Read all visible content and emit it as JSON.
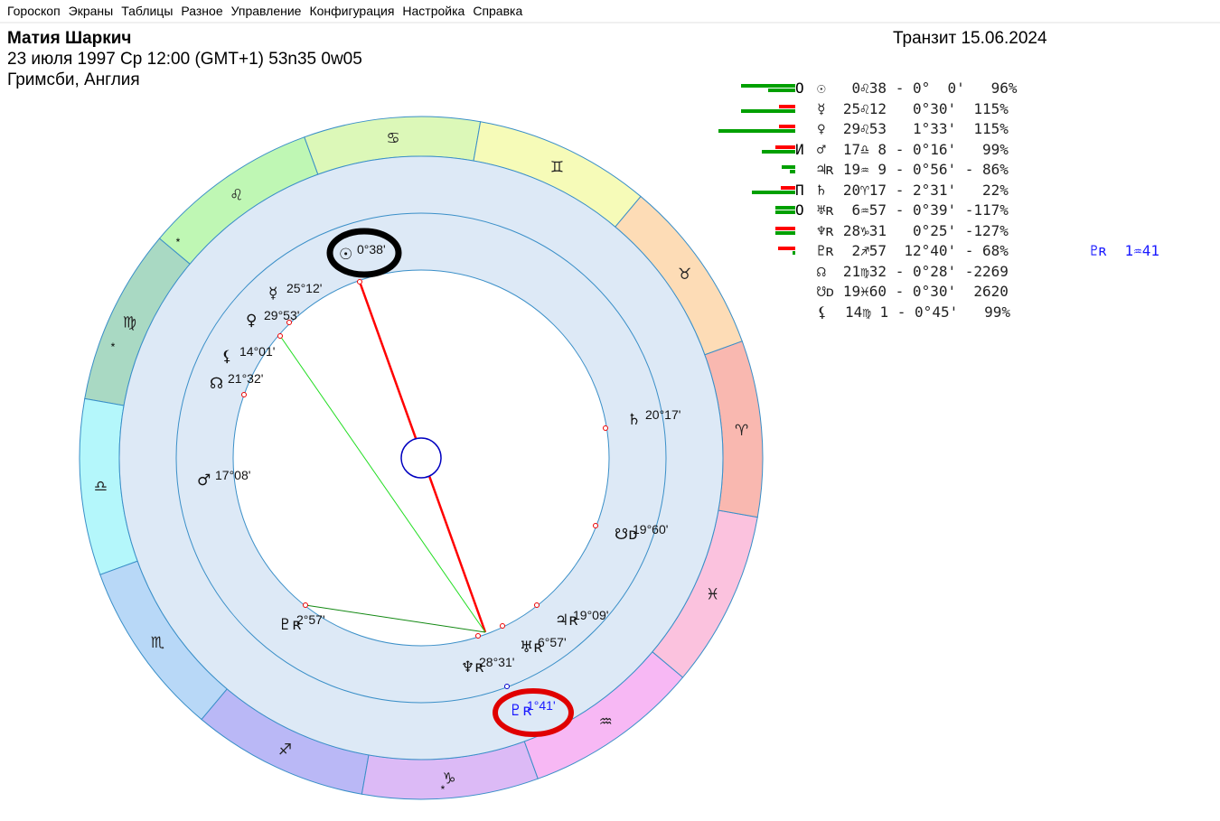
{
  "menu": [
    "Гороскоп",
    "Экраны",
    "Таблицы",
    "Разное",
    "Управление",
    "Конфигурация",
    "Настройка",
    "Справка"
  ],
  "header": {
    "name": "Матия Шаркич",
    "birth": "23 июля 1997  Ср  12:00 (GMT+1) 53n35  0w05",
    "place": "Гримсби, Англия",
    "transit": "Транзит 15.06.2024"
  },
  "colors": {
    "green_bar": "#00a000",
    "red_bar": "#ff0000",
    "ring": "#dde9f6",
    "transit_text": "#1a1aff",
    "highlight_black": "#000000",
    "highlight_red": "#e00000"
  },
  "table": [
    {
      "aspect": "O",
      "text": "☉   0♌38 - 0°  0'   96%",
      "green": [
        60,
        30
      ],
      "red": []
    },
    {
      "aspect": "",
      "text": "☿  25♌12   0°30'  115%",
      "green": [
        60
      ],
      "red": [
        18
      ]
    },
    {
      "aspect": "",
      "text": "♀  29♌53   1°33'  115%",
      "green": [
        85
      ],
      "red": [
        18
      ]
    },
    {
      "aspect": "И",
      "text": "♂  17♎ 8 - 0°16'   99%",
      "green": [
        37
      ],
      "red": [
        22
      ]
    },
    {
      "aspect": "",
      "text": "♃ʀ 19♒ 9 - 0°56' - 86%",
      "green": [
        15,
        6
      ],
      "red": []
    },
    {
      "aspect": "П",
      "text": "♄  20♈17 - 2°31'   22%",
      "green": [
        48
      ],
      "red": [
        16
      ]
    },
    {
      "aspect": "O",
      "text": "♅ʀ  6♒57 - 0°39' -117%",
      "green": [
        22,
        22
      ],
      "red": []
    },
    {
      "aspect": "",
      "text": "♆ʀ 28♑31   0°25' -127%",
      "green": [
        22
      ],
      "red": [
        22
      ]
    },
    {
      "aspect": "",
      "text": "♇ʀ  2♐57  12°40' - 68%",
      "green": [
        3
      ],
      "red": [
        19
      ],
      "transit": "♇ʀ  1♒41"
    },
    {
      "aspect": "",
      "text": "☊  21♍32 - 0°28' -2269",
      "green": [],
      "red": []
    },
    {
      "aspect": "",
      "text": "☋ᴅ 19♓60 - 0°30'  2620",
      "green": [],
      "red": []
    },
    {
      "aspect": "",
      "text": "⚸  14♍ 1 - 0°45'   99%",
      "green": [],
      "red": []
    }
  ],
  "zodiac": [
    {
      "sign": "♋",
      "color": "#dcf8b8"
    },
    {
      "sign": "♌",
      "color": "#bff7b4"
    },
    {
      "sign": "♍",
      "color": "#a9d9c3"
    },
    {
      "sign": "♎",
      "color": "#b4f7fb"
    },
    {
      "sign": "♏",
      "color": "#b8d8f7"
    },
    {
      "sign": "♐",
      "color": "#bab8f6"
    },
    {
      "sign": "♑",
      "color": "#dcbaf6"
    },
    {
      "sign": "♒",
      "color": "#f7b8f4"
    },
    {
      "sign": "♓",
      "color": "#fbc2de"
    },
    {
      "sign": "♈",
      "color": "#f9b8b0"
    },
    {
      "sign": "♉",
      "color": "#fddcb6"
    },
    {
      "sign": "♊",
      "color": "#f6fbb8"
    }
  ],
  "planets": [
    {
      "glyph": "☉",
      "label": "0°38'"
    },
    {
      "glyph": "☿",
      "label": "25°12'"
    },
    {
      "glyph": "♀",
      "label": "29°53'"
    },
    {
      "glyph": "⚸",
      "label": "14°01'"
    },
    {
      "glyph": "☊",
      "label": "21°32'"
    },
    {
      "glyph": "♂",
      "label": "17°08'"
    },
    {
      "glyph": "♄",
      "label": "20°17'"
    },
    {
      "glyph": "☋ᴅ",
      "label": "19°60'"
    },
    {
      "glyph": "♃ʀ",
      "label": "19°09'"
    },
    {
      "glyph": "♅ʀ",
      "label": "6°57'"
    },
    {
      "glyph": "♆ʀ",
      "label": "28°31'"
    },
    {
      "glyph": "♇ʀ",
      "label": "2°57'"
    },
    {
      "glyph": "♇ʀ",
      "label": "1°41'",
      "transit": true
    }
  ]
}
